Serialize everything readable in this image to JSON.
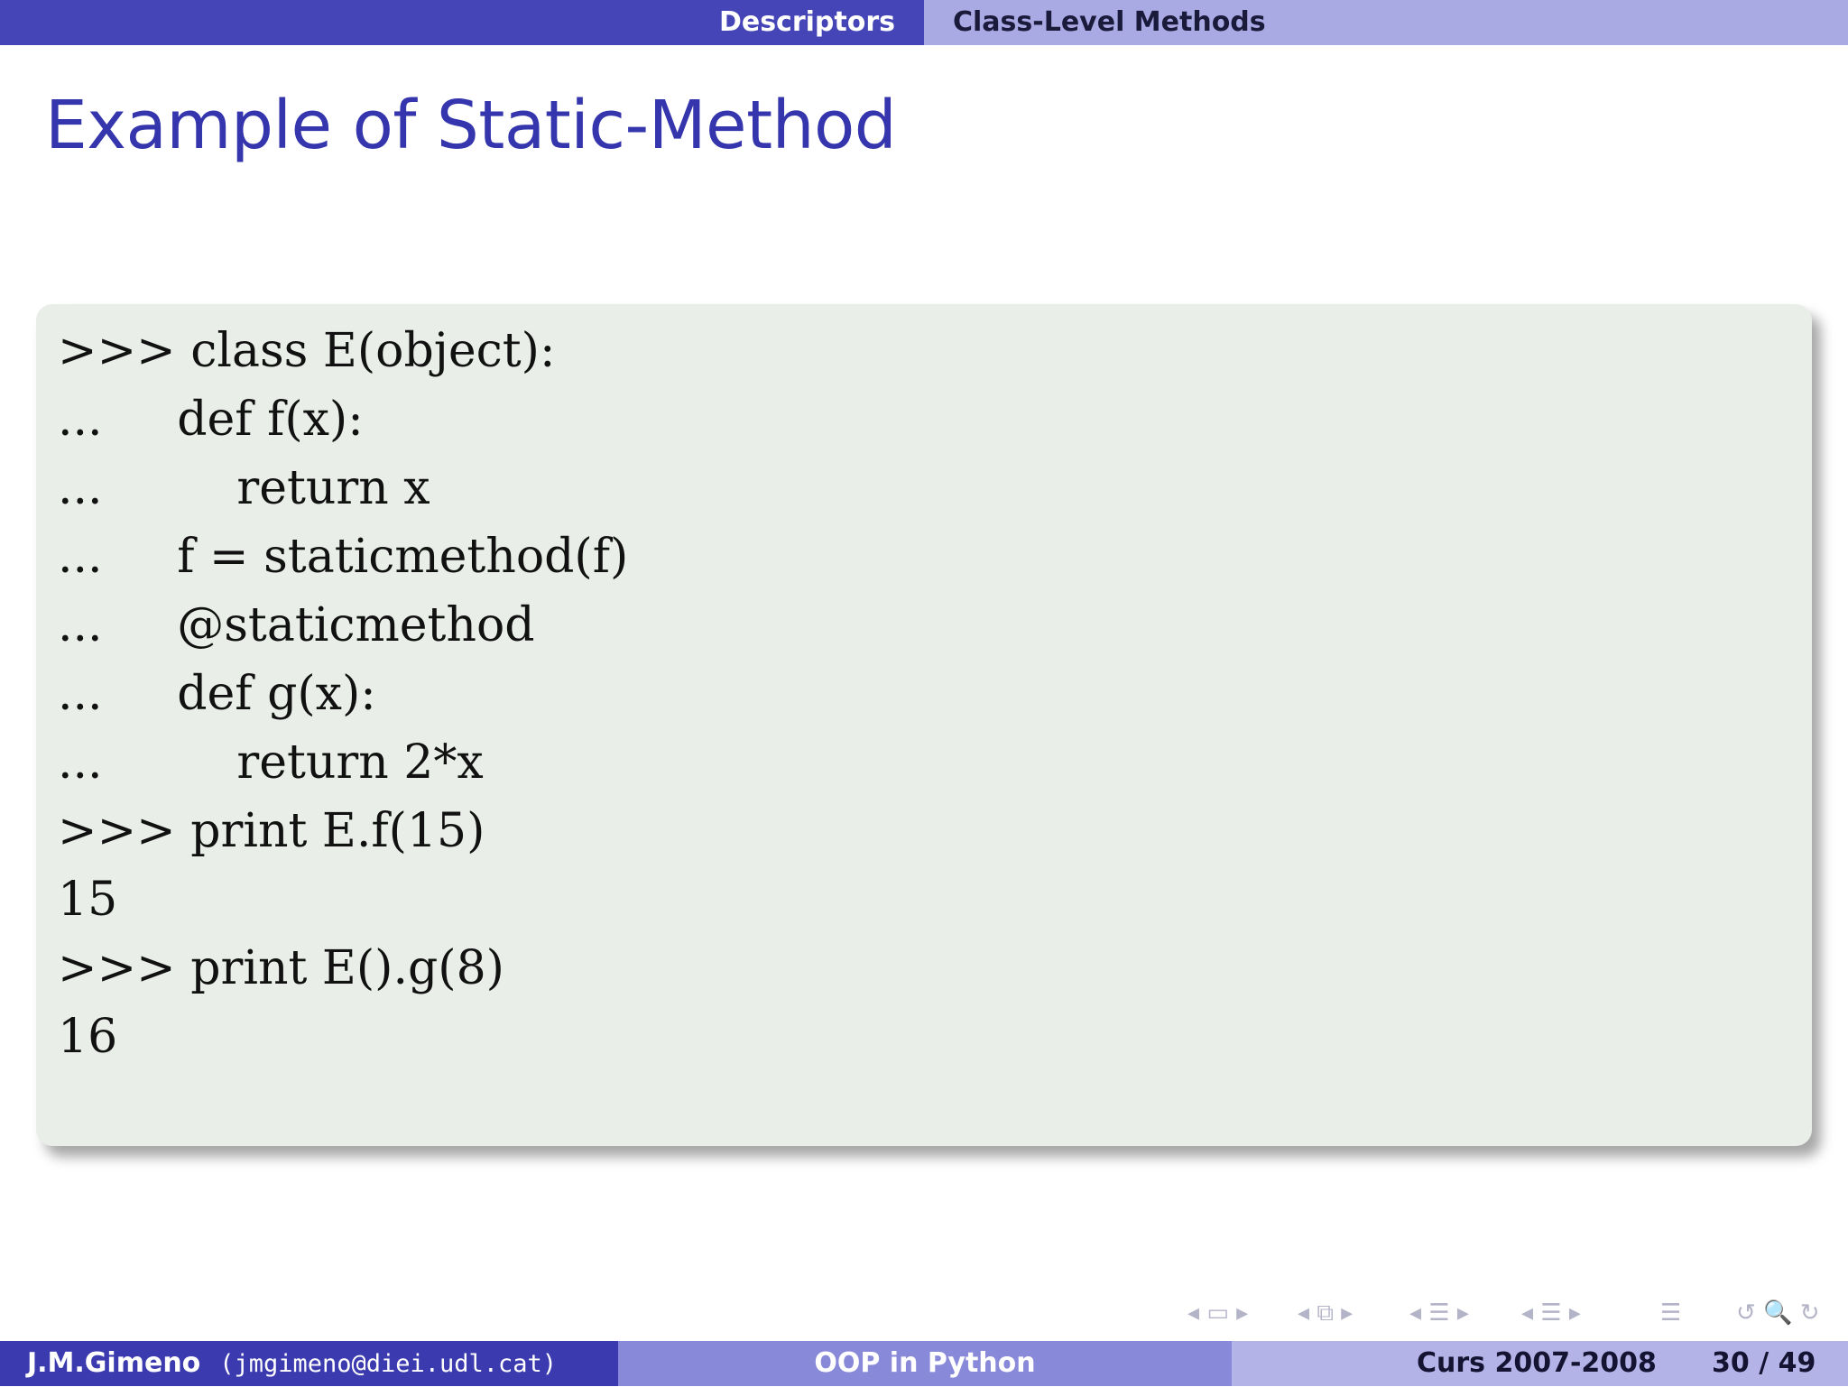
{
  "header": {
    "section": "Descriptors",
    "subsection": "Class-Level Methods"
  },
  "slide": {
    "title": "Example of Static-Method",
    "code_lines": [
      ">>> class E(object):",
      "...     def f(x):",
      "...         return x",
      "...     f = staticmethod(f)",
      "...     @staticmethod",
      "...     def g(x):",
      "...         return 2*x",
      ">>> print E.f(15)",
      "15",
      ">>> print E().g(8)",
      "16"
    ]
  },
  "nav_icons": {
    "frame_nav": "◂ ▭ ▸",
    "subsection_nav": "◂ ⧉ ▸",
    "section_nav": "◂ ☰ ▸",
    "subsection_list_nav": "◂ ☰ ▸",
    "toc": "☰",
    "search_undo": "↺ 🔍 ↻"
  },
  "footer": {
    "author": "J.M.Gimeno",
    "email": "(jmgimeno@diei.udl.cat)",
    "talk_title": "OOP in Python",
    "course": "Curs 2007-2008",
    "page": "30 / 49"
  },
  "colors": {
    "header_dark": "#4545b8",
    "header_light": "#a9a9e3",
    "title": "#3535ad",
    "code_background": "#e9efe8"
  }
}
